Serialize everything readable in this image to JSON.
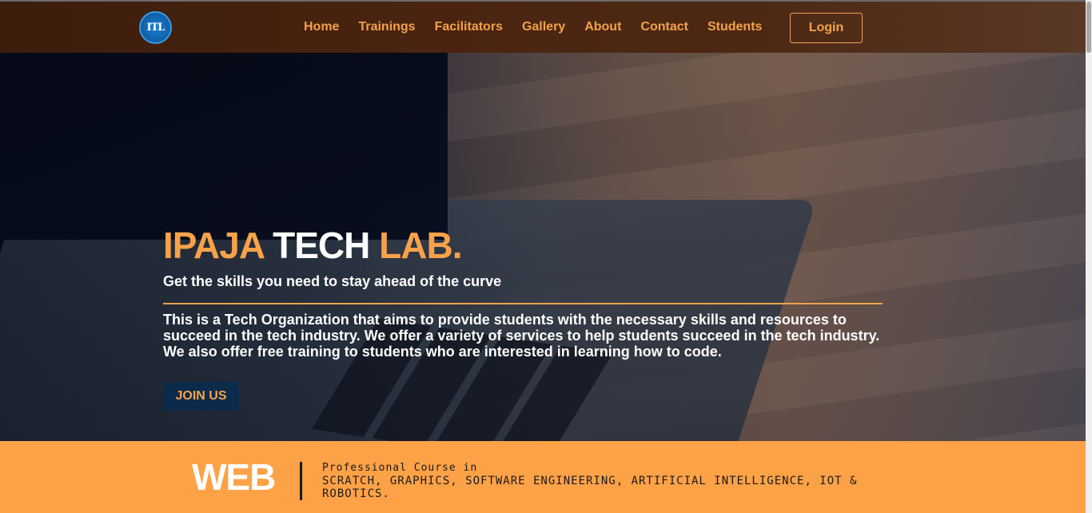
{
  "header": {
    "logo_icon": "ipaja-tech-lab-logo",
    "logo_text": "ITL",
    "nav": [
      {
        "label": "Home"
      },
      {
        "label": "Trainings"
      },
      {
        "label": "Facilitators"
      },
      {
        "label": "Gallery"
      },
      {
        "label": "About"
      },
      {
        "label": "Contact"
      },
      {
        "label": "Students"
      }
    ],
    "login_label": "Login"
  },
  "hero": {
    "title_part1": "IPAJA",
    "title_part2": "TECH",
    "title_part3": "LAB.",
    "subtitle": "Get the skills you need to stay ahead of the curve",
    "description_line1": "This is a Tech Organization that aims to provide students with the necessary skills and resources to succeed in the tech industry. We offer a variety of services to help students succeed in the tech industry.",
    "description_line2": "We also offer free training to students who are interested in learning how to code.",
    "cta_label": "JOIN US"
  },
  "banner": {
    "word": "WEB",
    "small_text": "Professional Course in",
    "courses": "SCRATCH, GRAPHICS, SOFTWARE ENGINEERING, ARTIFICIAL INTELLIGENCE, IOT & ROBOTICS."
  },
  "colors": {
    "accent_orange": "#f7a24a",
    "nav_brown": "#4a2410",
    "banner_orange": "#fea247",
    "button_navy": "#0c2a4a"
  }
}
